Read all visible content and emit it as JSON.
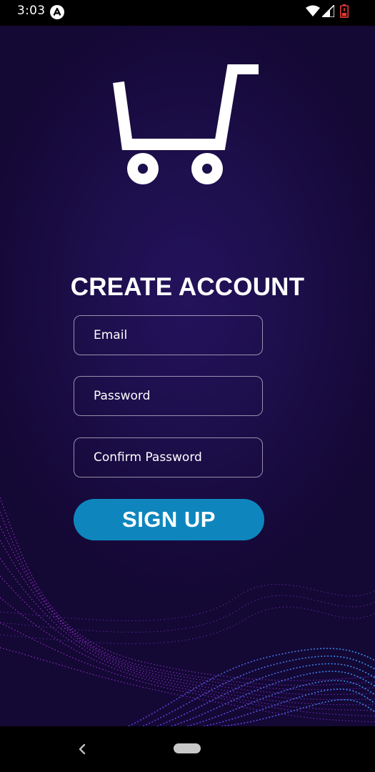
{
  "status_bar": {
    "time": "3:03",
    "icons": [
      "app-notification-icon",
      "wifi-icon",
      "signal-icon",
      "battery-icon"
    ],
    "battery_color": "#e53935"
  },
  "app": {
    "logo_icon": "shopping-cart-icon",
    "title": "CREATE ACCOUNT",
    "form": {
      "email_placeholder": "Email",
      "password_placeholder": "Password",
      "confirm_password_placeholder": "Confirm Password",
      "signup_label": "SIGN UP"
    },
    "colors": {
      "background": "#1d0f4c",
      "button": "#0e86bd",
      "wave_purple": "#b43cf0",
      "wave_blue": "#3c8cff"
    }
  },
  "nav_bar": {
    "icons": [
      "back-icon",
      "home-pill"
    ]
  }
}
